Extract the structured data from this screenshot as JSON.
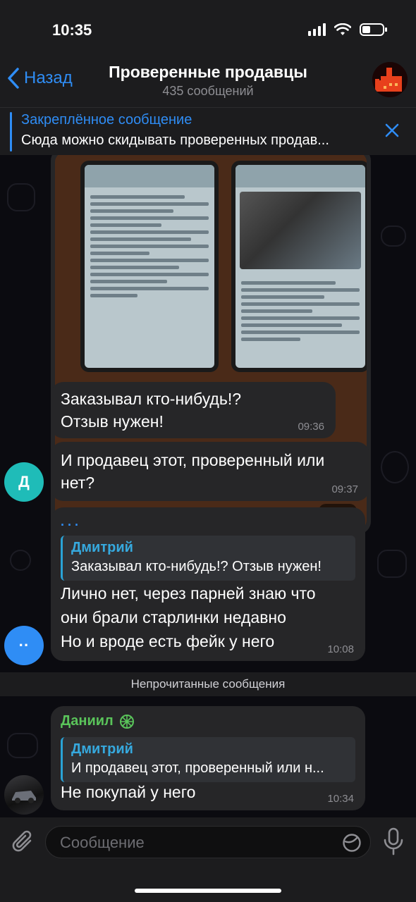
{
  "status": {
    "time": "10:35"
  },
  "header": {
    "back_label": "Назад",
    "title": "Проверенные продавцы",
    "subtitle": "435 сообщений"
  },
  "pinned": {
    "title": "Закреплённое сообщение",
    "text": "Сюда можно скидывать проверенных продав..."
  },
  "messages": {
    "image": {
      "time": "09:36"
    },
    "m1": {
      "text": "Заказывал кто-нибудь!? Отзыв нужен!",
      "time": "09:36"
    },
    "m2": {
      "text": "И продавец этот, проверенный или нет?",
      "time": "09:37",
      "avatar_letter": "Д",
      "avatar_color": "#1fbcb8"
    },
    "m3": {
      "sender": ". . .",
      "reply_name": "Дмитрий",
      "reply_text": "Заказывал кто-нибудь!? Отзыв нужен!",
      "line1": "Лично нет, через парней знаю что",
      "line2": "они брали старлинки недавно",
      "line3": "Но и вроде есть фейк у него",
      "time": "10:08",
      "avatar_letter": "··",
      "avatar_color": "#2f8df5"
    },
    "unread_label": "Непрочитанные сообщения",
    "m4": {
      "sender": "Даниил",
      "sender_color": "#5ac45a",
      "reply_name": "Дмитрий",
      "reply_text": "И продавец этот, проверенный или н...",
      "text": "Не покупай у него",
      "time": "10:34"
    }
  },
  "composer": {
    "placeholder": "Сообщение"
  }
}
